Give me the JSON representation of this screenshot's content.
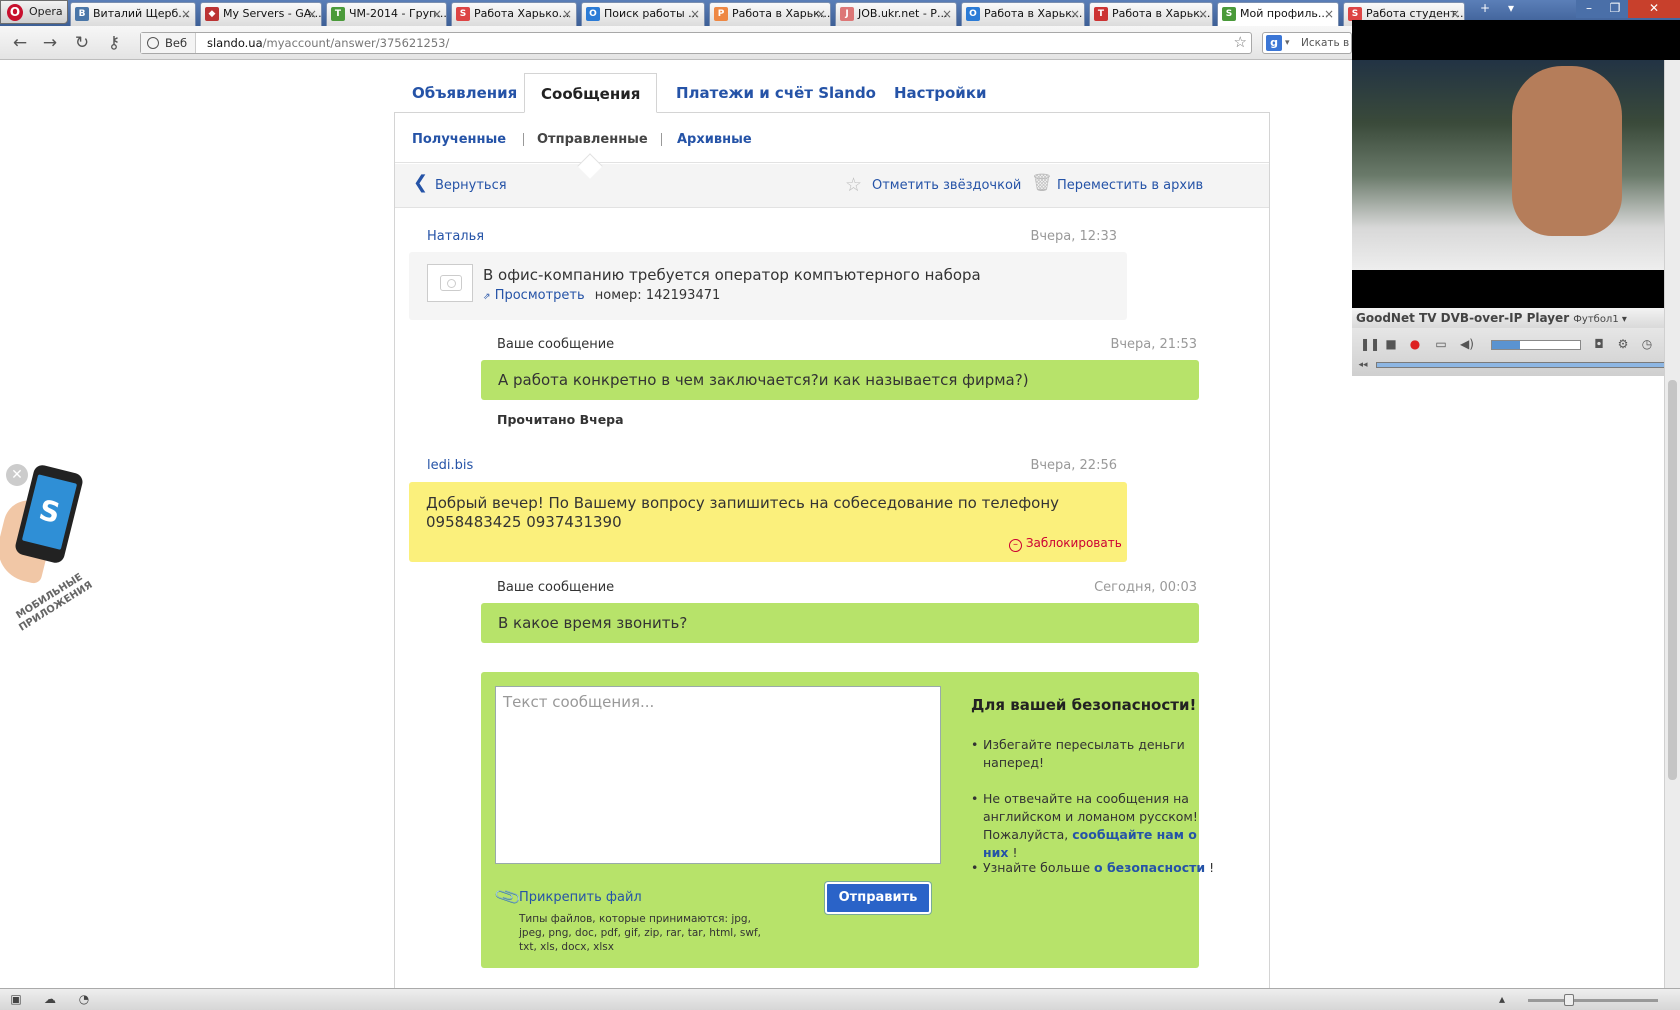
{
  "browser": {
    "menu_label": "Opera",
    "tabs": [
      {
        "label": "Виталий Щерб...",
        "fav": "В",
        "fav_color": "#4a76a8"
      },
      {
        "label": "My Servers - GA...",
        "fav": "◆",
        "fav_color": "#b33"
      },
      {
        "label": "ЧМ-2014 - Груп...",
        "fav": "T",
        "fav_color": "#4a9a3a"
      },
      {
        "label": "Работа Харько...",
        "fav": "S",
        "fav_color": "#d44"
      },
      {
        "label": "Поиск работы ...",
        "fav": "O",
        "fav_color": "#2b7bd6"
      },
      {
        "label": "Работа в Харьк...",
        "fav": "P",
        "fav_color": "#e84"
      },
      {
        "label": "JOB.ukr.net - Р...",
        "fav": "J",
        "fav_color": "#d77"
      },
      {
        "label": "Работа в Харьк...",
        "fav": "O",
        "fav_color": "#2b7bd6"
      },
      {
        "label": "Работа в Харьк...",
        "fav": "T",
        "fav_color": "#c33"
      },
      {
        "label": "Мой профиль...",
        "fav": "S",
        "fav_color": "#4a9a3a"
      },
      {
        "label": "Работа студент...",
        "fav": "S",
        "fav_color": "#d44"
      }
    ],
    "address_prefix": "Веб",
    "url_host": "slando.ua",
    "url_path": "/myaccount/answer/375621253/",
    "search_placeholder": "Искать в"
  },
  "nav": {
    "tabs": [
      "Объявления",
      "Сообщения",
      "Платежи и счёт Slando",
      "Настройки"
    ],
    "sub": [
      "Полученные",
      "Отправленные",
      "Архивные"
    ],
    "back": "Вернуться",
    "star": "Отметить звёздочкой",
    "archive": "Переместить в архив"
  },
  "thread": {
    "ad": {
      "author": "Наталья",
      "time": "Вчера, 12:33",
      "title": "В офис-компанию требуется оператор компъютерного набора",
      "view_link": "Просмотреть",
      "number_label": "номер:",
      "number": "142193471"
    },
    "m1": {
      "label": "Ваше сообщение",
      "time": "Вчера, 21:53",
      "text": "А работа конкретно в чем заключается?и как называется фирма?)",
      "read": "Прочитано Вчера"
    },
    "m2": {
      "author": "ledi.bis",
      "time": "Вчера, 22:56",
      "text": "Добрый вечер! По Вашему вопросу запишитесь на собеседование по телефону 0958483425 0937431390",
      "block": "Заблокировать"
    },
    "m3": {
      "label": "Ваше сообщение",
      "time": "Сегодня, 00:03",
      "text": "В какое время звонить?"
    }
  },
  "reply": {
    "placeholder": "Текст сообщения...",
    "attach": "Прикрепить файл",
    "types": "Типы файлов, которые принимаются: jpg, jpeg, png, doc, pdf, gif, zip, rar, tar, html, swf, txt, xls, docx, xlsx",
    "send": "Отправить"
  },
  "safety": {
    "title": "Для вашей безопасности!",
    "b1": "Избегайте пересылать деньги наперед!",
    "b2_pre": "Не отвечайте на сообщения на английском и ломаном русском! Пожалуйста,",
    "b2_link": "сообщайте нам о них",
    "b2_post": "!",
    "b3_pre": "Узнайте больше",
    "b3_link": "о безопасности",
    "b3_post": "!"
  },
  "side_widget": {
    "text": "МОБИЛЬНЫЕ ПРИЛОЖЕНИЯ",
    "phone_letter": "S"
  },
  "player": {
    "title": "GoodNet TV DVB-over-IP Player",
    "channel": "Футбол1 ▾"
  },
  "colors": {
    "link": "#2553a7",
    "green": "#b7e36a",
    "yellow": "#fbf07c",
    "send": "#2a63c8"
  }
}
